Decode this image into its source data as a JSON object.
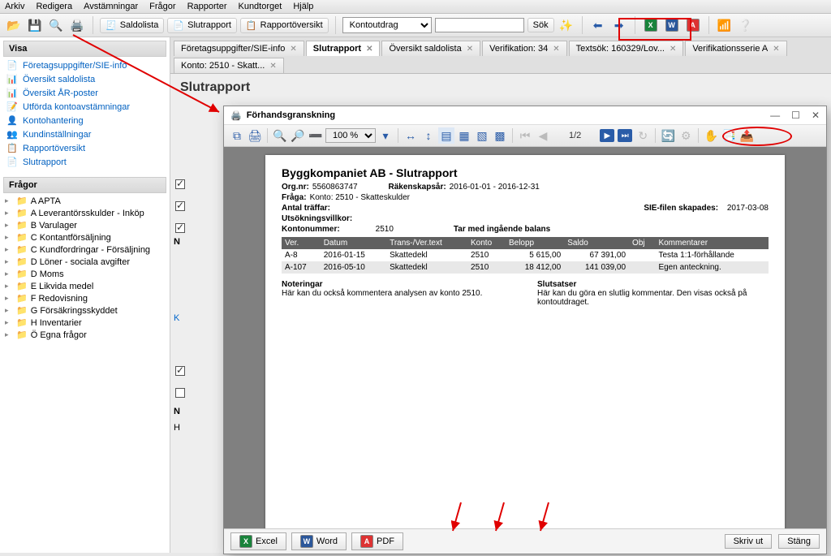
{
  "menu": [
    "Arkiv",
    "Redigera",
    "Avstämningar",
    "Frågor",
    "Rapporter",
    "Kundtorget",
    "Hjälp"
  ],
  "toolbar": {
    "saldolista": "Saldolista",
    "slutrapport": "Slutrapport",
    "rapportoversikt": "Rapportöversikt",
    "filter_selected": "Kontoutdrag",
    "sok": "Sök"
  },
  "sidebar": {
    "visa_header": "Visa",
    "visa": [
      {
        "icon": "📄",
        "label": "Företagsuppgifter/SIE-info"
      },
      {
        "icon": "📊",
        "label": "Översikt saldolista"
      },
      {
        "icon": "📊",
        "label": "Översikt ÅR-poster"
      },
      {
        "icon": "📝",
        "label": "Utförda kontoavstämningar"
      },
      {
        "icon": "👤",
        "label": "Kontohantering"
      },
      {
        "icon": "👥",
        "label": "Kundinställningar"
      },
      {
        "icon": "📋",
        "label": "Rapportöversikt"
      },
      {
        "icon": "📄",
        "label": "Slutrapport"
      }
    ],
    "fragor_header": "Frågor",
    "fragor": [
      "A APTA",
      "A Leverantörsskulder - Inköp",
      "B Varulager",
      "C Kontantförsäljning",
      "C Kundfordringar - Försäljning",
      "D Löner - sociala avgifter",
      "D Moms",
      "E Likvida medel",
      "F Redovisning",
      "G Försäkringsskyddet",
      "H Inventarier",
      "Ö Egna frågor"
    ]
  },
  "tabs": [
    {
      "label": "Företagsuppgifter/SIE-info"
    },
    {
      "label": "Slutrapport",
      "active": true
    },
    {
      "label": "Översikt saldolista"
    },
    {
      "label": "Verifikation: 34"
    },
    {
      "label": "Textsök: 160329/Lov..."
    },
    {
      "label": "Verifikationsserie A"
    },
    {
      "label": "Konto: 2510 - Skatt..."
    }
  ],
  "page_title": "Slutrapport",
  "preview": {
    "title": "Förhandsgranskning",
    "zoom": "100 %",
    "page_indicator": "1/2",
    "footer": {
      "excel": "Excel",
      "word": "Word",
      "pdf": "PDF",
      "print": "Skriv ut",
      "close": "Stäng"
    }
  },
  "report": {
    "title": "Byggkompaniet AB - Slutrapport",
    "orgnr_label": "Org.nr:",
    "orgnr": "5560863747",
    "rakenskap_label": "Räkenskapsår:",
    "rakenskap": "2016-01-01 - 2016-12-31",
    "fraga_label": "Fråga:",
    "fraga": "Konto: 2510 - Skatteskulder",
    "antal_traffar_label": "Antal träffar:",
    "siefile_label": "SIE-filen skapades:",
    "siefile": "2017-03-08",
    "utsok_label": "Utsökningsvillkor:",
    "kontonr_label": "Kontonummer:",
    "kontonr": "2510",
    "tarmed_label": "Tar med ingående balans",
    "columns": [
      "Ver.",
      "Datum",
      "Trans-/Ver.text",
      "Konto",
      "Belopp",
      "Saldo",
      "Obj",
      "Kommentarer"
    ],
    "rows": [
      {
        "ver": "A-8",
        "datum": "2016-01-15",
        "text": "Skattedekl",
        "konto": "2510",
        "belopp": "5 615,00",
        "saldo": "67 391,00",
        "obj": "",
        "komm": "Testa 1:1-förhållande"
      },
      {
        "ver": "A-107",
        "datum": "2016-05-10",
        "text": "Skattedekl",
        "konto": "2510",
        "belopp": "18 412,00",
        "saldo": "141 039,00",
        "obj": "",
        "komm": "Egen anteckning."
      }
    ],
    "noteringar_h": "Noteringar",
    "noteringar_t": "Här kan du också kommentera analysen av konto 2510.",
    "slutsatser_h": "Slutsatser",
    "slutsatser_t": "Här kan du göra en slutlig kommentar. Den visas också på kontoutdraget."
  },
  "bg": {
    "k": "K",
    "n": "N",
    "ha": "H"
  }
}
